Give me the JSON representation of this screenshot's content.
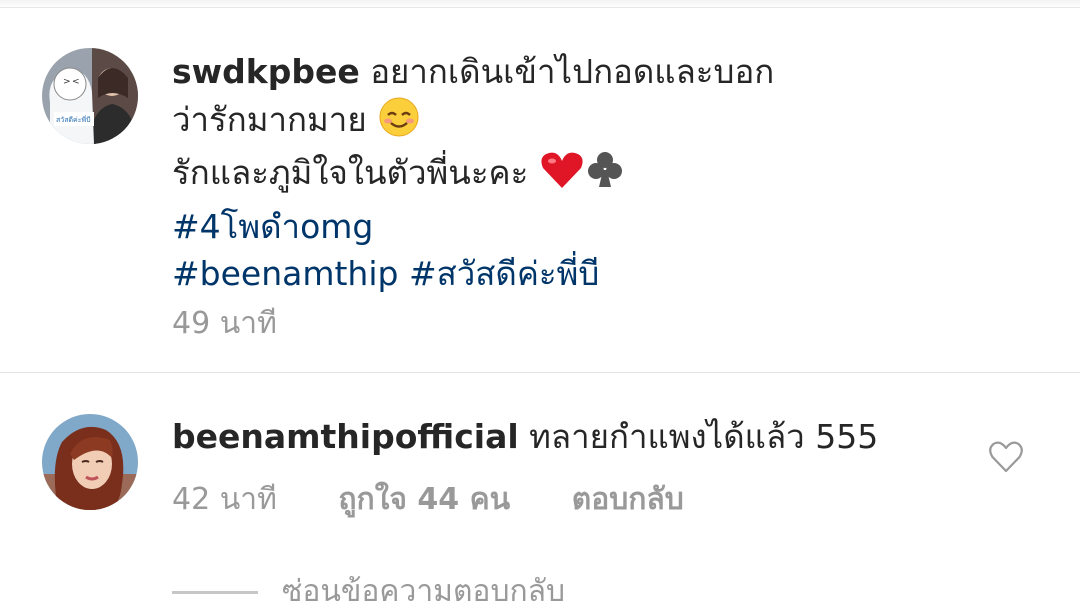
{
  "comments": [
    {
      "username": "swdkpbee",
      "lines": [
        "อยากเดินเข้าไปกอดและบอก",
        "ว่ารักมากมาย",
        "รักและภูมิใจในตัวพี่นะคะ"
      ],
      "hashtags": [
        "#4โพดำomg",
        "#beenamthip #สวัสดีค่ะพี่บี"
      ],
      "time": "49 นาที",
      "avatar_caption": "สวัสดีค่ะพี่บี"
    },
    {
      "username": "beenamthipofficial",
      "text": "ทลายกำแพงได้แล้ว 555",
      "time": "42 นาที",
      "likes": "ถูกใจ 44 คน",
      "reply": "ตอบกลับ"
    }
  ],
  "hide_replies": "ซ่อนข้อความตอบกลับ",
  "icons": {
    "emoji_smile": "smiling-face-icon",
    "emoji_heart": "red-heart-icon",
    "emoji_club": "club-suit-icon",
    "like": "heart-outline-icon"
  }
}
